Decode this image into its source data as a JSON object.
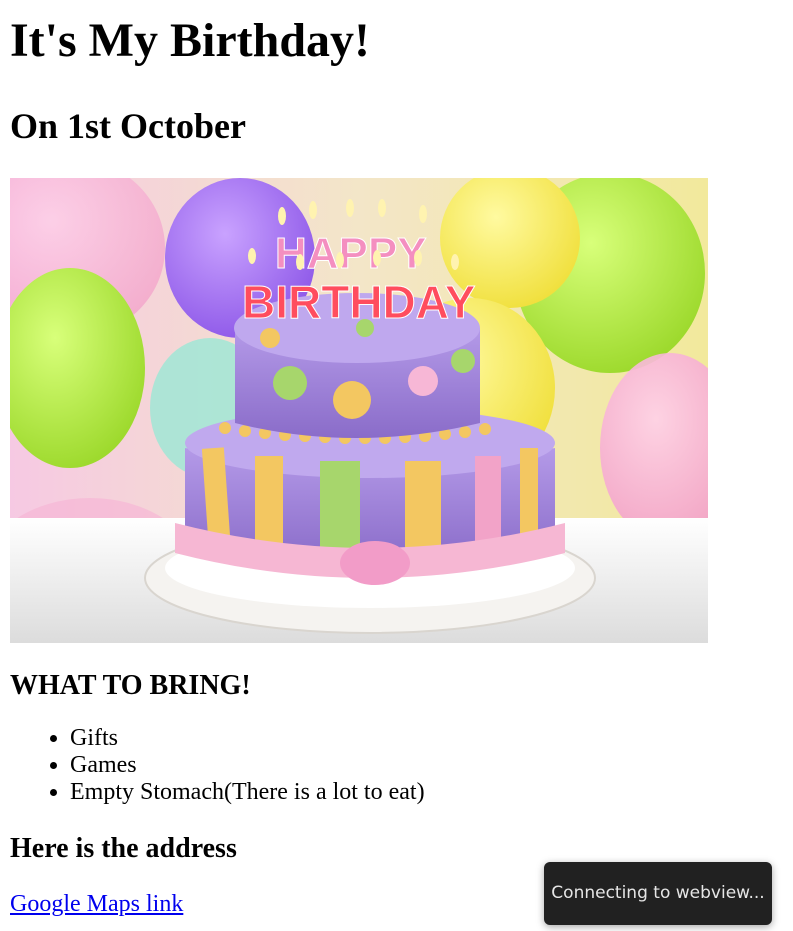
{
  "page": {
    "title": "It's My Birthday!",
    "subtitle": "On 1st October",
    "hero_image": {
      "alt": "Happy Birthday cake",
      "cake_text_top": "HAPPY",
      "cake_text_bottom": "BIRTHDAY"
    },
    "bring_heading": "WHAT TO BRING!",
    "bring_items": [
      "Gifts",
      "Games",
      "Empty Stomach(There is a lot to eat)"
    ],
    "address_heading": "Here is the address",
    "maps_link": "Google Maps link"
  },
  "toast": {
    "message": "Connecting to webview..."
  }
}
